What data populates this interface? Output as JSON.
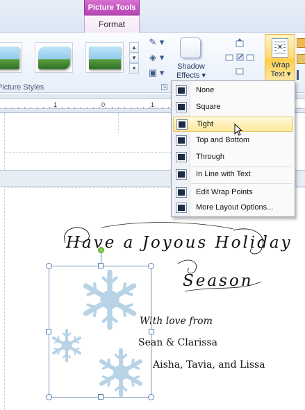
{
  "ribbon": {
    "context_tab": "Picture Tools",
    "active_tab": "Format",
    "group_picture_styles": "Picture Styles",
    "shadow_effects_line1": "Shadow",
    "shadow_effects_line2": "Effects ▾",
    "wrap_text_line1": "Wrap",
    "wrap_text_line2": "Text ▾"
  },
  "ruler": {
    "mark_1": "1",
    "mark_0": "0",
    "mark_right": "1"
  },
  "wrap_menu": {
    "items": [
      {
        "label": "None",
        "icon": "wrap-none-icon"
      },
      {
        "label": "Square",
        "icon": "wrap-square-icon"
      },
      {
        "label": "Tight",
        "icon": "wrap-tight-icon",
        "highlighted": true
      },
      {
        "label": "Top and Bottom",
        "icon": "wrap-top-bottom-icon"
      },
      {
        "label": "Through",
        "icon": "wrap-through-icon"
      },
      {
        "label": "In Line with Text",
        "icon": "wrap-inline-icon"
      },
      {
        "label": "Edit Wrap Points",
        "icon": "edit-wrap-points-icon"
      },
      {
        "label": "More Layout Options...",
        "icon": "layout-options-icon"
      }
    ]
  },
  "document": {
    "heading_line1": "Have a Joyous Holiday",
    "heading_line2": "Season",
    "with_love": "With love from",
    "names_1": "Sean & Clarissa",
    "names_2": "Aisha, Tavia, and Lissa"
  },
  "colors": {
    "picture_tools_tab": "#c04fc0",
    "wrap_button_highlight": "#ffd971",
    "snowflake": "#b8d3e6"
  }
}
